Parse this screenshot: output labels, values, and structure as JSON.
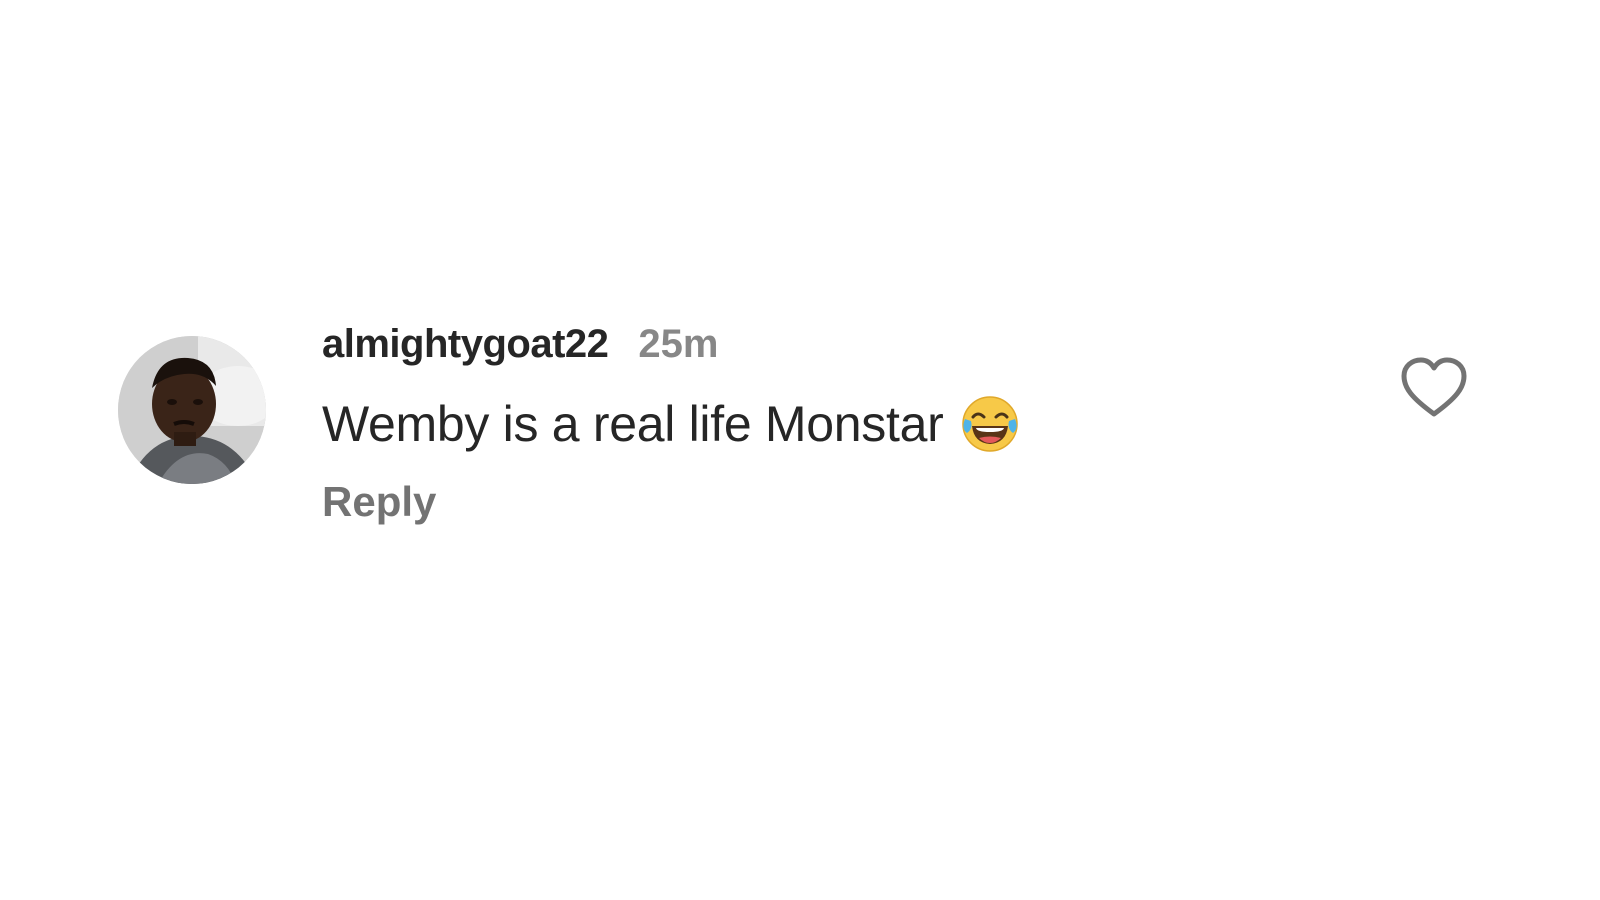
{
  "comment": {
    "username": "almightygoat22",
    "timestamp": "25m",
    "text": "Wemby is a real life Monstar",
    "emoji": "face-with-tears-of-joy-icon",
    "reply_label": "Reply"
  },
  "icons": {
    "like": "heart-outline-icon",
    "avatar": "user-avatar"
  },
  "colors": {
    "background": "#ffffff",
    "primary_text": "#262626",
    "secondary_text": "#737373",
    "heart_stroke": "#737373",
    "emoji_face": "#f7c948",
    "emoji_tears": "#4fb3e8"
  }
}
